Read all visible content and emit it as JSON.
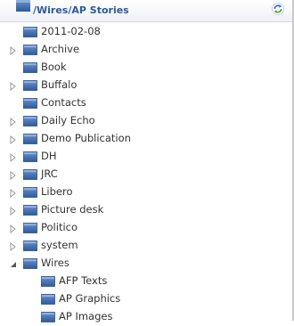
{
  "header": {
    "path": "/Wires/AP Stories",
    "folder_icon": "folder-icon",
    "refresh_icon": "refresh-icon"
  },
  "colors": {
    "folder_top": "#5b84c4",
    "folder_bottom": "#2f5a9a",
    "header_text": "#2d5a9c",
    "arrow": "#9a9a9a"
  },
  "tree": {
    "items": [
      {
        "label": "2011-02-08",
        "expander": "none"
      },
      {
        "label": "Archive",
        "expander": "collapsed"
      },
      {
        "label": "Book",
        "expander": "none"
      },
      {
        "label": "Buffalo",
        "expander": "collapsed"
      },
      {
        "label": "Contacts",
        "expander": "none"
      },
      {
        "label": "Daily Echo",
        "expander": "collapsed"
      },
      {
        "label": "Demo Publication",
        "expander": "collapsed"
      },
      {
        "label": "DH",
        "expander": "collapsed"
      },
      {
        "label": "JRC",
        "expander": "collapsed"
      },
      {
        "label": "Libero",
        "expander": "collapsed"
      },
      {
        "label": "Picture desk",
        "expander": "collapsed"
      },
      {
        "label": "Politico",
        "expander": "collapsed"
      },
      {
        "label": "system",
        "expander": "collapsed"
      },
      {
        "label": "Wires",
        "expander": "expanded"
      }
    ],
    "children": [
      {
        "label": "AFP Texts"
      },
      {
        "label": "AP Graphics"
      },
      {
        "label": "AP Images"
      }
    ]
  }
}
